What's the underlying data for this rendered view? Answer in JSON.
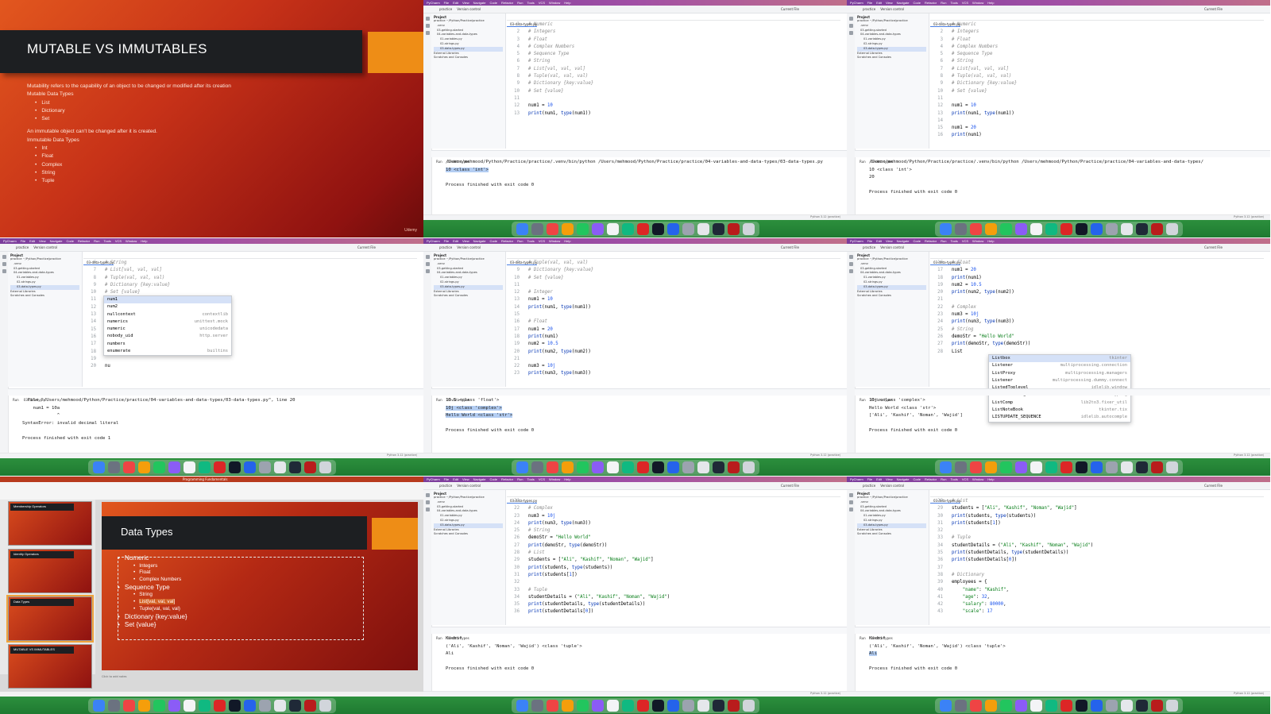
{
  "slide1": {
    "title": "MUTABLE VS IMMUTABLES",
    "intro": "Mutability refers to the capability of an object to be changed or modified after its creation",
    "mutable_heading": "Mutable Data Types",
    "mutable_items": [
      "List",
      "Dictionary",
      "Set"
    ],
    "immutable_intro": "An immutable object can't be changed after it is created.",
    "immutable_heading": "Immutable Data Types",
    "immutable_items": [
      "Int",
      "Float",
      "Complex",
      "String",
      "Tuple"
    ],
    "footer": "Udemy"
  },
  "ide": {
    "app": "PyCharm",
    "menu": [
      "File",
      "Edit",
      "View",
      "Navigate",
      "Code",
      "Refactor",
      "Run",
      "Tools",
      "VCS",
      "Window",
      "Help"
    ],
    "project_label": "practice",
    "vcs_label": "Version control",
    "run_config": "Current File",
    "tab": "03-data-types.py",
    "project_title": "Project",
    "tree": [
      "practice ~/Python/Practice/practice",
      ".venv",
      "03-getting-started",
      "04-variables-and-data-types",
      "01-variables.py",
      "02-strings.py",
      "03-data-types.py",
      "External Libraries",
      "Scratches and Consoles"
    ],
    "run_tab": "Run",
    "run_name": "03-data-types",
    "status": "practice > 04-variables-and-data-types > 03-data-types.py",
    "status_right": "Python 3.12 (practice)"
  },
  "p2": {
    "lines": [
      {
        "n": "1",
        "code": "# Numeric"
      },
      {
        "n": "2",
        "code": "# Integers"
      },
      {
        "n": "3",
        "code": "# Float"
      },
      {
        "n": "4",
        "code": "# Complex Numbers"
      },
      {
        "n": "5",
        "code": "# Sequence Type"
      },
      {
        "n": "6",
        "code": "# String"
      },
      {
        "n": "7",
        "code": "# List[val, val, val]"
      },
      {
        "n": "8",
        "code": "# Tuple(val, val, val)"
      },
      {
        "n": "9",
        "code": "# Dictionary {key:value}"
      },
      {
        "n": "10",
        "code": "# Set {value}"
      },
      {
        "n": "11",
        "code": ""
      },
      {
        "n": "12",
        "code": "num1 = 10"
      },
      {
        "n": "13",
        "code": "print(num1, type(num1))"
      }
    ],
    "output": [
      "/Users/mehmood/Python/Practice/practice/.venv/bin/python /Users/mehmood/Python/Practice/practice/04-variables-and-data-types/03-data-types.py",
      "10 <class 'int'>",
      "",
      "Process finished with exit code 0"
    ]
  },
  "p3": {
    "lines": [
      {
        "n": "1",
        "code": "# Numeric"
      },
      {
        "n": "2",
        "code": "# Integers"
      },
      {
        "n": "3",
        "code": "# Float"
      },
      {
        "n": "4",
        "code": "# Complex Numbers"
      },
      {
        "n": "5",
        "code": "# Sequence Type"
      },
      {
        "n": "6",
        "code": "# String"
      },
      {
        "n": "7",
        "code": "# List[val, val, val]"
      },
      {
        "n": "8",
        "code": "# Tuple(val, val, val)"
      },
      {
        "n": "9",
        "code": "# Dictionary {key:value}"
      },
      {
        "n": "10",
        "code": "# Set {value}"
      },
      {
        "n": "11",
        "code": ""
      },
      {
        "n": "12",
        "code": "num1 = 10"
      },
      {
        "n": "13",
        "code": "print(num1, type(num1))"
      },
      {
        "n": "14",
        "code": ""
      },
      {
        "n": "15",
        "code": "num1 = 20"
      },
      {
        "n": "16",
        "code": "print(num1)"
      }
    ],
    "output": [
      "/Users/mehmood/Python/Practice/practice/.venv/bin/python /Users/mehmood/Python/Practice/practice/04-variables-and-data-types/",
      "10 <class 'int'>",
      "20",
      "",
      "Process finished with exit code 0"
    ]
  },
  "p4": {
    "lines": [
      {
        "n": "6",
        "code": "# String"
      },
      {
        "n": "7",
        "code": "# List[val, val, val]"
      },
      {
        "n": "8",
        "code": "# Tuple(val, val, val)"
      },
      {
        "n": "9",
        "code": "# Dictionary {key:value}"
      },
      {
        "n": "10",
        "code": "# Set {value}"
      },
      {
        "n": "11",
        "code": ""
      },
      {
        "n": "12",
        "code": ""
      },
      {
        "n": "13",
        "code": ""
      },
      {
        "n": "14",
        "code": ""
      },
      {
        "n": "15",
        "code": ""
      },
      {
        "n": "16",
        "code": ""
      },
      {
        "n": "17",
        "code": ""
      },
      {
        "n": "18",
        "code": ""
      },
      {
        "n": "19",
        "code": ""
      },
      {
        "n": "20",
        "code": "nu"
      }
    ],
    "completion": [
      {
        "name": "num1",
        "src": ""
      },
      {
        "name": "num2",
        "src": ""
      },
      {
        "name": "nullcontext",
        "src": "contextlib"
      },
      {
        "name": "numerics",
        "src": "unittest.mock"
      },
      {
        "name": "numeric",
        "src": "unicodedata"
      },
      {
        "name": "nobody_uid",
        "src": "http.server"
      },
      {
        "name": "numbers",
        "src": ""
      },
      {
        "name": "enumerate",
        "src": "builtins"
      }
    ],
    "output": [
      "  File \"/Users/mehmood/Python/Practice/practice/04-variables-and-data-types/03-data-types.py\", line 20",
      "    num1 = 10a",
      "             ^",
      "SyntaxError: invalid decimal literal",
      "",
      "Process finished with exit code 1"
    ]
  },
  "p5": {
    "lines": [
      {
        "n": "8",
        "code": "# Tuple(val, val, val)"
      },
      {
        "n": "9",
        "code": "# Dictionary {key:value}"
      },
      {
        "n": "10",
        "code": "# Set {value}"
      },
      {
        "n": "11",
        "code": ""
      },
      {
        "n": "12",
        "code": "# Integer"
      },
      {
        "n": "13",
        "code": "num1 = 10"
      },
      {
        "n": "14",
        "code": "print(num1, type(num1))"
      },
      {
        "n": "15",
        "code": ""
      },
      {
        "n": "16",
        "code": "# Float"
      },
      {
        "n": "17",
        "code": "num1 = 20"
      },
      {
        "n": "18",
        "code": "print(num1)"
      },
      {
        "n": "19",
        "code": "num2 = 10.5"
      },
      {
        "n": "20",
        "code": "print(num2, type(num2))"
      },
      {
        "n": "21",
        "code": ""
      },
      {
        "n": "22",
        "code": "num3 = 10j"
      },
      {
        "n": "23",
        "code": "print(num3, type(num3))"
      }
    ],
    "output": [
      "10.5 <class 'float'>",
      "10j <class 'complex'>",
      "Hello World <class 'str'>",
      "",
      "Process finished with exit code 0"
    ]
  },
  "p6": {
    "lines": [
      {
        "n": "16",
        "code": "# Float"
      },
      {
        "n": "17",
        "code": "num1 = 20"
      },
      {
        "n": "18",
        "code": "print(num1)"
      },
      {
        "n": "19",
        "code": "num2 = 10.5"
      },
      {
        "n": "20",
        "code": "print(num2, type(num2))"
      },
      {
        "n": "21",
        "code": ""
      },
      {
        "n": "22",
        "code": "# Complex"
      },
      {
        "n": "23",
        "code": "num3 = 10j"
      },
      {
        "n": "24",
        "code": "print(num3, type(num3))"
      },
      {
        "n": "25",
        "code": "# String"
      },
      {
        "n": "26",
        "code": "demoStr = \"Hello World\""
      },
      {
        "n": "27",
        "code": "print(demoStr, type(demoStr))"
      },
      {
        "n": "28",
        "code": "List"
      }
    ],
    "completion": [
      {
        "name": "Listbox",
        "src": "tkinter"
      },
      {
        "name": "Listener",
        "src": "multiprocessing.connection"
      },
      {
        "name": "ListProxy",
        "src": "multiprocessing.managers"
      },
      {
        "name": "Listener",
        "src": "multiprocessing.dummy.connect"
      },
      {
        "name": "ListedToplevel",
        "src": "idlelib.window"
      },
      {
        "name": "LiteralString",
        "src": "typing"
      },
      {
        "name": "ListComp",
        "src": "lib2to3.fixer_util"
      },
      {
        "name": "ListNoteBook",
        "src": "tkinter.tix"
      },
      {
        "name": "LISTUPDATE_SEQUENCE",
        "src": "idlelib.autocomple"
      }
    ],
    "output": [
      "10j <class 'complex'>",
      "Hello World <class 'str'>",
      "['Ali', 'Kashif', 'Noman', 'Wajid']",
      "",
      "Process finished with exit code 0"
    ]
  },
  "p7": {
    "title": "Data Types",
    "header": "Programming Fundamentals",
    "thumbs": [
      "Membership Operators",
      "Identity Operators",
      "Data Types",
      "MUTABLE VS IMMUTABLES"
    ],
    "items": [
      {
        "lvl": 1,
        "text": "Numeric"
      },
      {
        "lvl": 2,
        "text": "Integers"
      },
      {
        "lvl": 2,
        "text": "Float"
      },
      {
        "lvl": 2,
        "text": "Complex Numbers"
      },
      {
        "lvl": 1,
        "text": "Sequence Type"
      },
      {
        "lvl": 2,
        "text": "String"
      },
      {
        "lvl": 2,
        "text": "List[val, val, val]"
      },
      {
        "lvl": 2,
        "text": "Tuple(val, val, val)"
      },
      {
        "lvl": 1,
        "text": "Dictionary {key:value}"
      },
      {
        "lvl": 1,
        "text": "Set {value}"
      }
    ],
    "notes": "Click to add notes"
  },
  "p8": {
    "lines": [
      {
        "n": "21",
        "code": ""
      },
      {
        "n": "22",
        "code": "# Complex"
      },
      {
        "n": "23",
        "code": "num3 = 10j"
      },
      {
        "n": "24",
        "code": "print(num3, type(num3))"
      },
      {
        "n": "25",
        "code": "# String"
      },
      {
        "n": "26",
        "code": "demoStr = \"Hello World\""
      },
      {
        "n": "27",
        "code": "print(demoStr, type(demoStr))"
      },
      {
        "n": "28",
        "code": "# List"
      },
      {
        "n": "29",
        "code": "students = [\"Ali\", \"Kashif\", \"Noman\", \"Wajid\"]"
      },
      {
        "n": "30",
        "code": "print(students, type(students))"
      },
      {
        "n": "31",
        "code": "print(students[1])"
      },
      {
        "n": "32",
        "code": ""
      },
      {
        "n": "33",
        "code": "# Tuple"
      },
      {
        "n": "34",
        "code": "studentDetails = (\"Ali\", \"Kashif\", \"Noman\", \"Wajid\")"
      },
      {
        "n": "35",
        "code": "print(studentDetails, type(studentDetails))"
      },
      {
        "n": "36",
        "code": "print(studentDetails[0])"
      }
    ],
    "output": [
      "Kashif",
      "('Ali', 'Kashif', 'Noman', 'Wajid') <class 'tuple'>",
      "Ali",
      "",
      "Process finished with exit code 0"
    ]
  },
  "p9": {
    "lines": [
      {
        "n": "28",
        "code": "# List"
      },
      {
        "n": "29",
        "code": "students = [\"Ali\", \"Kashif\", \"Noman\", \"Wajid\"]"
      },
      {
        "n": "30",
        "code": "print(students, type(students))"
      },
      {
        "n": "31",
        "code": "print(students[1])"
      },
      {
        "n": "32",
        "code": ""
      },
      {
        "n": "33",
        "code": "# Tuple"
      },
      {
        "n": "34",
        "code": "studentDetails = (\"Ali\", \"Kashif\", \"Noman\", \"Wajid\")"
      },
      {
        "n": "35",
        "code": "print(studentDetails, type(studentDetails))"
      },
      {
        "n": "36",
        "code": "print(studentDetails[0])"
      },
      {
        "n": "37",
        "code": ""
      },
      {
        "n": "38",
        "code": "# Dictionary"
      },
      {
        "n": "39",
        "code": "employees = {"
      },
      {
        "n": "40",
        "code": "    \"name\": \"Kashif\","
      },
      {
        "n": "41",
        "code": "    \"age\": 32,"
      },
      {
        "n": "42",
        "code": "    \"salary\": 80000,"
      },
      {
        "n": "43",
        "code": "    \"scale\": 17"
      }
    ],
    "output": [
      "Kashif",
      "('Ali', 'Kashif', 'Noman', 'Wajid') <class 'tuple'>",
      "Ali",
      "",
      "Process finished with exit code 0"
    ]
  },
  "dock_colors": [
    "#3b82f6",
    "#6b7280",
    "#ef4444",
    "#f59e0b",
    "#22c55e",
    "#8b5cf6",
    "#f3f4f6",
    "#10b981",
    "#dc2626",
    "#111827",
    "#2563eb",
    "#9ca3af",
    "#e5e7eb",
    "#1f2937",
    "#b91c1c",
    "#d1d5db"
  ]
}
